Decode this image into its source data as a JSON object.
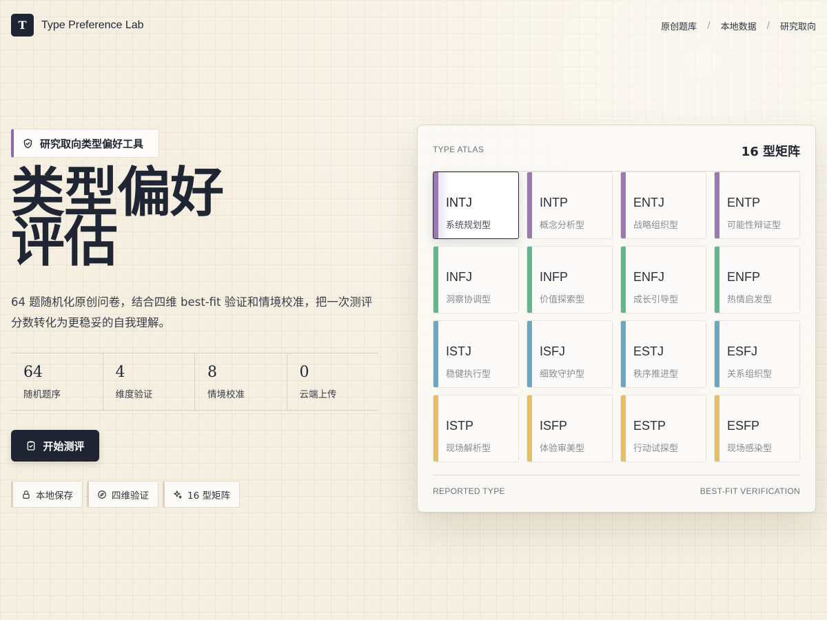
{
  "header": {
    "logo_letter": "T",
    "brand": "Type Preference Lab",
    "nav": [
      "原创题库",
      "本地数据",
      "研究取向"
    ],
    "nav_separator": "/"
  },
  "hero": {
    "badge": "研究取向类型偏好工具",
    "title_line1": "类型偏好",
    "title_line2": "评估",
    "description": "64 题随机化原创问卷，结合四维 best-fit 验证和情境校准，把一次测评分数转化为更稳妥的自我理解。",
    "stats": [
      {
        "value": "64",
        "label": "随机题序"
      },
      {
        "value": "4",
        "label": "维度验证"
      },
      {
        "value": "8",
        "label": "情境校准"
      },
      {
        "value": "0",
        "label": "云端上传"
      }
    ],
    "start_button": "开始测评",
    "chips": [
      {
        "label": "本地保存",
        "icon": "lock-icon"
      },
      {
        "label": "四维验证",
        "icon": "compass-icon"
      },
      {
        "label": "16 型矩阵",
        "icon": "sparkles-icon"
      }
    ]
  },
  "atlas": {
    "kicker": "TYPE ATLAS",
    "title": "16 型矩阵",
    "footer_left": "REPORTED TYPE",
    "footer_right": "BEST-FIT VERIFICATION",
    "selected": "INTJ",
    "group_colors": {
      "purple": "#9b78b6",
      "green": "#5fb98e",
      "blue": "#69a9c4",
      "yellow": "#e6bf62"
    },
    "types": [
      {
        "code": "INTJ",
        "name": "系统规划型",
        "group": "purple"
      },
      {
        "code": "INTP",
        "name": "概念分析型",
        "group": "purple"
      },
      {
        "code": "ENTJ",
        "name": "战略组织型",
        "group": "purple"
      },
      {
        "code": "ENTP",
        "name": "可能性辩证型",
        "group": "purple"
      },
      {
        "code": "INFJ",
        "name": "洞察协调型",
        "group": "green"
      },
      {
        "code": "INFP",
        "name": "价值探索型",
        "group": "green"
      },
      {
        "code": "ENFJ",
        "name": "成长引导型",
        "group": "green"
      },
      {
        "code": "ENFP",
        "name": "热情启发型",
        "group": "green"
      },
      {
        "code": "ISTJ",
        "name": "稳健执行型",
        "group": "blue"
      },
      {
        "code": "ISFJ",
        "name": "细致守护型",
        "group": "blue"
      },
      {
        "code": "ESTJ",
        "name": "秩序推进型",
        "group": "blue"
      },
      {
        "code": "ESFJ",
        "name": "关系组织型",
        "group": "blue"
      },
      {
        "code": "ISTP",
        "name": "现场解析型",
        "group": "yellow"
      },
      {
        "code": "ISFP",
        "name": "体验审美型",
        "group": "yellow"
      },
      {
        "code": "ESTP",
        "name": "行动试探型",
        "group": "yellow"
      },
      {
        "code": "ESFP",
        "name": "现场感染型",
        "group": "yellow"
      }
    ]
  }
}
